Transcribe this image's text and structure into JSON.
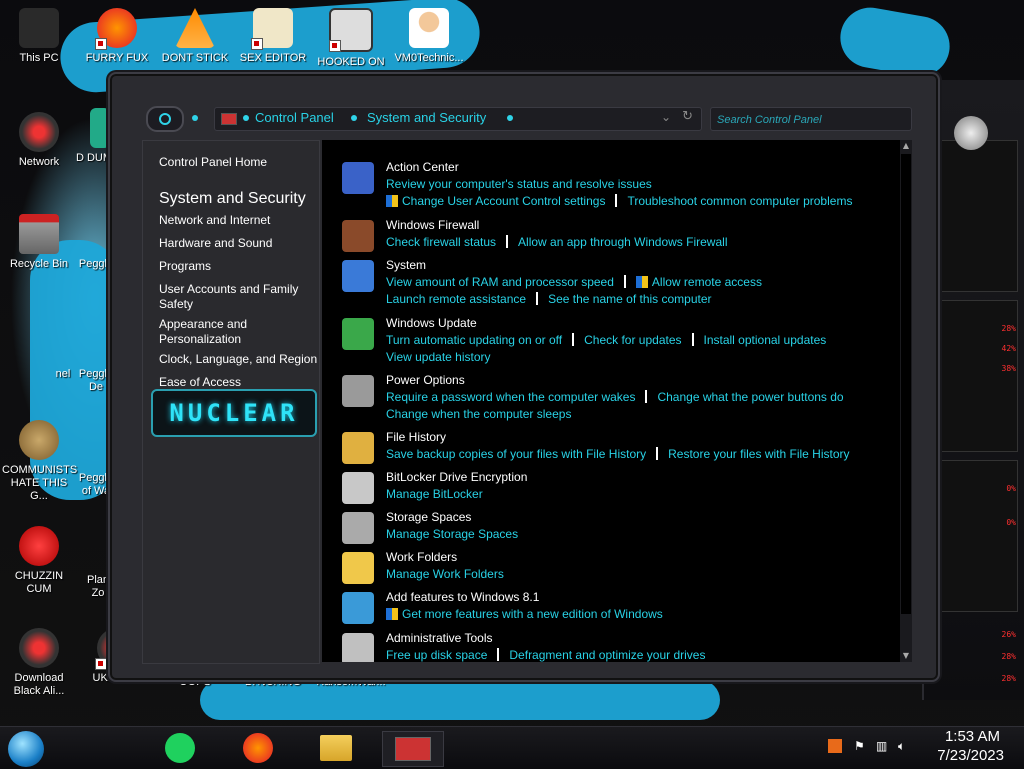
{
  "desktop": {
    "icons": [
      {
        "label": "This PC"
      },
      {
        "label": "FURRY FUX"
      },
      {
        "label": "DONT STICK"
      },
      {
        "label": "SEX EDITOR"
      },
      {
        "label": "HOOKED ON"
      },
      {
        "label": "VM0Technic..."
      },
      {
        "label": "Network"
      },
      {
        "label": "Recycle Bin"
      },
      {
        "label": "COMMUNISTS HATE THIS G..."
      },
      {
        "label": "CHUZZIN CUM"
      },
      {
        "label": "Download Black Ali..."
      },
      {
        "label": "UKRAINE"
      },
      {
        "label": "OOPS"
      },
      {
        "label": "LYNCHING"
      },
      {
        "label": "RansomWar..."
      }
    ],
    "partial_labels": {
      "d_dum": "D DUM",
      "peggle1": "Peggle",
      "peggle2": "Peggle De",
      "peggle3": "Peggle of Wa",
      "nel": "nel",
      "plan": "Plan Zo"
    }
  },
  "side_panel": {
    "percents": [
      "28%",
      "42%",
      "38%",
      "0%",
      "0%",
      "26%",
      "28%",
      "28%"
    ],
    "accent": "#ff3030"
  },
  "window": {
    "breadcrumb": [
      "Control Panel",
      "System and Security"
    ],
    "search_placeholder": "Search Control Panel",
    "left_nav": {
      "home": "Control Panel Home",
      "current": "System and Security",
      "items": [
        "Network and Internet",
        "Hardware and Sound",
        "Programs",
        "User Accounts and Family Safety",
        "Appearance and Personalization",
        "Clock, Language, and Region",
        "Ease of Access"
      ],
      "logo_text": "NUCLEAR"
    },
    "categories": [
      {
        "title": "Action Center",
        "icon": "flag-icon",
        "rows": [
          [
            "Review your computer's status and resolve issues"
          ],
          [
            "*Change User Account Control settings",
            "Troubleshoot common computer problems"
          ]
        ]
      },
      {
        "title": "Windows Firewall",
        "icon": "firewall-icon",
        "rows": [
          [
            "Check firewall status",
            "Allow an app through Windows Firewall"
          ]
        ]
      },
      {
        "title": "System",
        "icon": "system-icon",
        "rows": [
          [
            "View amount of RAM and processor speed",
            "*Allow remote access"
          ],
          [
            "Launch remote assistance",
            "See the name of this computer"
          ]
        ]
      },
      {
        "title": "Windows Update",
        "icon": "update-icon",
        "rows": [
          [
            "Turn automatic updating on or off",
            "Check for updates",
            "Install optional updates"
          ],
          [
            "View update history"
          ]
        ]
      },
      {
        "title": "Power Options",
        "icon": "power-icon",
        "rows": [
          [
            "Require a password when the computer wakes",
            "Change what the power buttons do"
          ],
          [
            "Change when the computer sleeps"
          ]
        ]
      },
      {
        "title": "File History",
        "icon": "file-history-icon",
        "rows": [
          [
            "Save backup copies of your files with File History",
            "Restore your files with File History"
          ]
        ]
      },
      {
        "title": "BitLocker Drive Encryption",
        "icon": "bitlocker-icon",
        "rows": [
          [
            "Manage BitLocker"
          ]
        ]
      },
      {
        "title": "Storage Spaces",
        "icon": "storage-icon",
        "rows": [
          [
            "Manage Storage Spaces"
          ]
        ]
      },
      {
        "title": "Work Folders",
        "icon": "work-folders-icon",
        "rows": [
          [
            "Manage Work Folders"
          ]
        ]
      },
      {
        "title": "Add features to Windows 8.1",
        "icon": "add-features-icon",
        "rows": [
          [
            "*Get more features with a new edition of Windows"
          ]
        ]
      },
      {
        "title": "Administrative Tools",
        "icon": "admin-tools-icon",
        "rows": [
          [
            "Free up disk space",
            "Defragment and optimize your drives"
          ]
        ]
      }
    ]
  },
  "taskbar": {
    "time": "1:53 AM",
    "date": "7/23/2023"
  },
  "colors": {
    "link": "#29d2e6",
    "accent_blue": "#1ea7d8"
  }
}
